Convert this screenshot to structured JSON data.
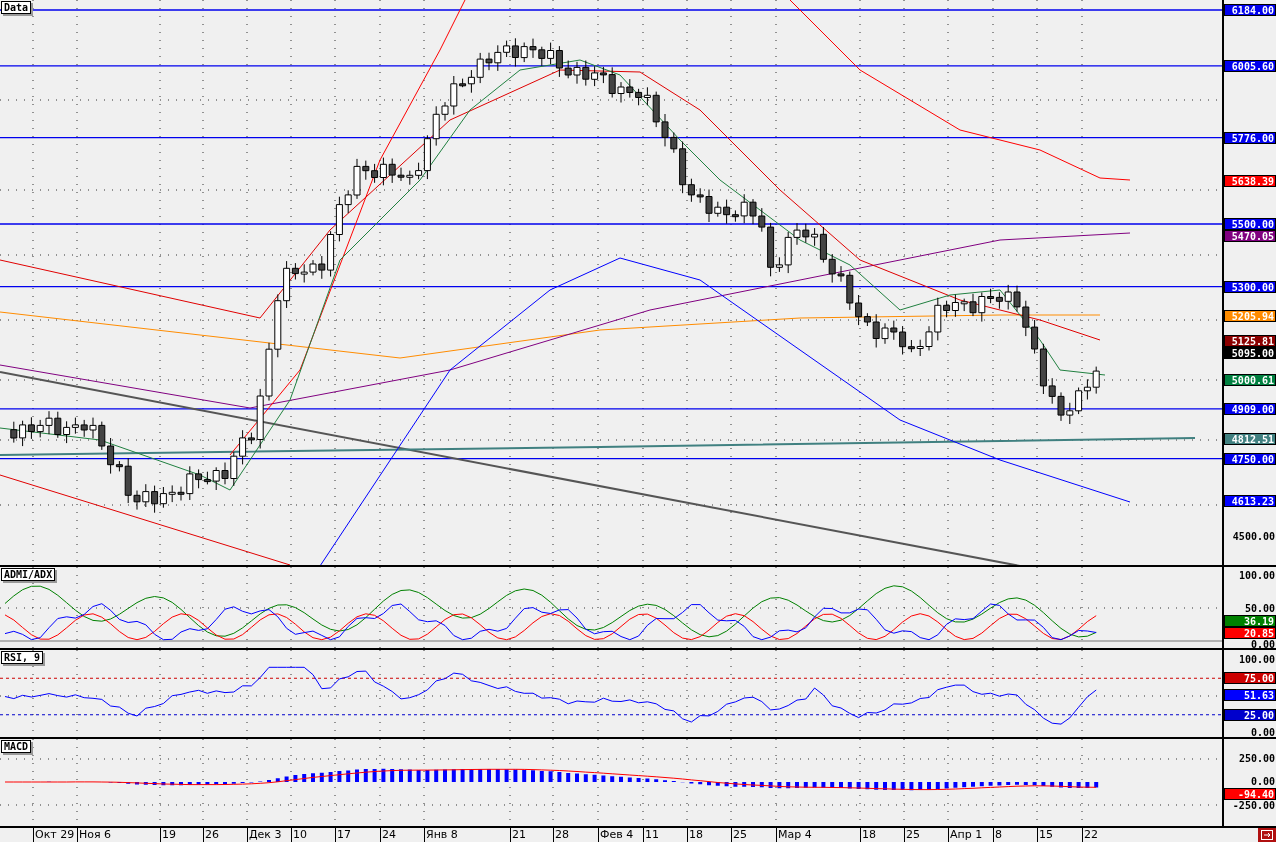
{
  "main_panel": {
    "title": "Data",
    "axis_labels": [
      {
        "text": "6184.00",
        "kind": "level",
        "color": "#0000ee"
      },
      {
        "text": "6005.60",
        "kind": "level",
        "color": "#0000ee"
      },
      {
        "text": "5776.00",
        "kind": "level",
        "color": "#0000ee"
      },
      {
        "text": "5638.39",
        "kind": "tag",
        "color": "#ff0000"
      },
      {
        "text": "5500.00",
        "kind": "level",
        "color": "#0000ee"
      },
      {
        "text": "5470.05",
        "kind": "tag",
        "color": "#800080"
      },
      {
        "text": "5300.00",
        "kind": "level",
        "color": "#0000ee"
      },
      {
        "text": "5205.94",
        "kind": "tag",
        "color": "#ff8c00"
      },
      {
        "text": "5125.81",
        "kind": "tag",
        "color": "#8b0000"
      },
      {
        "text": "5095.00",
        "kind": "tag",
        "color": "#000000"
      },
      {
        "text": "5000.61",
        "kind": "tag",
        "color": "#008040"
      },
      {
        "text": "4909.00",
        "kind": "level",
        "color": "#0000ee"
      },
      {
        "text": "4812.51",
        "kind": "tag",
        "color": "#408080"
      },
      {
        "text": "4750.00",
        "kind": "level",
        "color": "#0000ee"
      },
      {
        "text": "4613.23",
        "kind": "tag",
        "color": "#0000ff"
      },
      {
        "text": "4500.00",
        "kind": "plain"
      }
    ]
  },
  "adx_panel": {
    "title": "ADMI/ADX",
    "axis_labels": [
      {
        "text": "100.00",
        "kind": "plain"
      },
      {
        "text": "50.00",
        "kind": "plain"
      },
      {
        "text": "36.19",
        "kind": "tag",
        "color": "#008000"
      },
      {
        "text": "20.85",
        "kind": "tag",
        "color": "#ff0000"
      },
      {
        "text": "0.00",
        "kind": "plain"
      }
    ]
  },
  "rsi_panel": {
    "title": "RSI, 9",
    "axis_labels": [
      {
        "text": "100.00",
        "kind": "plain"
      },
      {
        "text": "75.00",
        "kind": "dashed-level",
        "color": "#cc0000"
      },
      {
        "text": "51.63",
        "kind": "tag",
        "color": "#0000ff"
      },
      {
        "text": "25.00",
        "kind": "dashed-level",
        "color": "#0000cc"
      },
      {
        "text": "0.00",
        "kind": "plain"
      }
    ]
  },
  "macd_panel": {
    "title": "MACD",
    "axis_labels": [
      {
        "text": "250.00",
        "kind": "plain"
      },
      {
        "text": "0.00",
        "kind": "plain"
      },
      {
        "text": "-94.40",
        "kind": "tag",
        "color": "#ff0000"
      },
      {
        "text": "-250.00",
        "kind": "plain"
      }
    ]
  },
  "date_axis": [
    "Окт 29",
    "Ноя 6",
    "19",
    "26",
    "Дек 3",
    "10",
    "17",
    "24",
    "Янв 8",
    "21",
    "28",
    "Фев 4",
    "11",
    "18",
    "25",
    "Мар 4",
    "18",
    "25",
    "Апр 1",
    "8",
    "15",
    "22"
  ]
}
